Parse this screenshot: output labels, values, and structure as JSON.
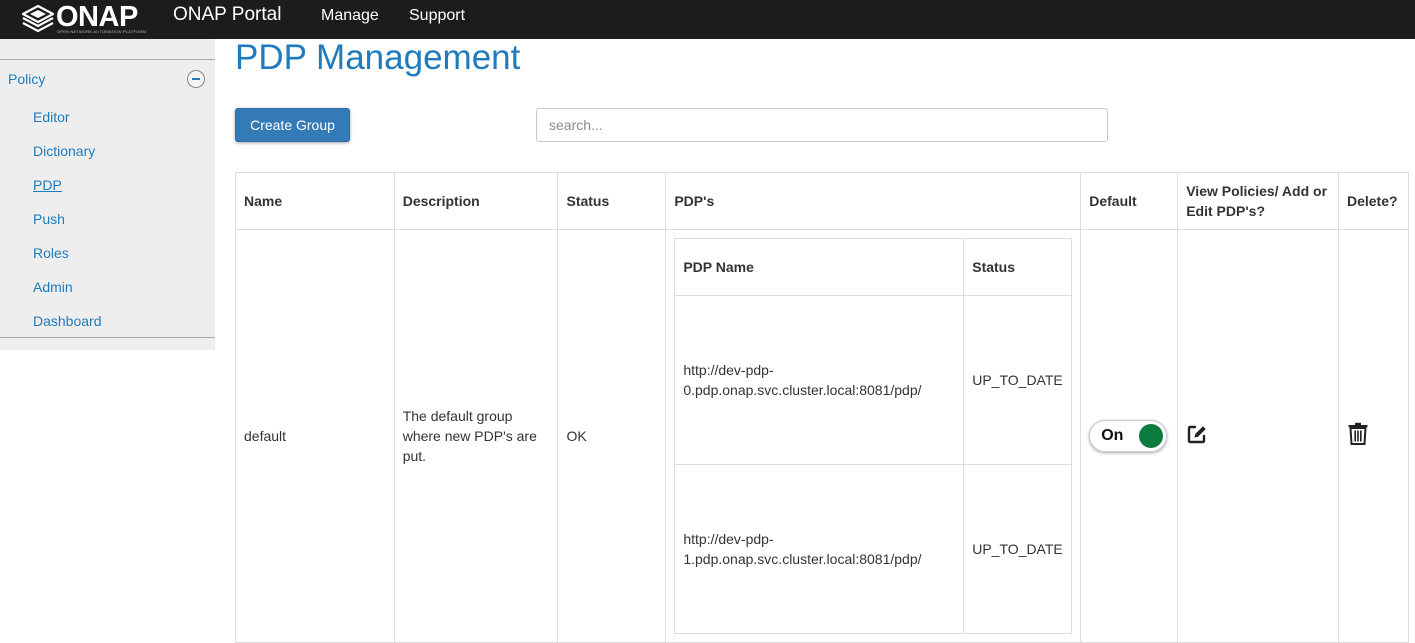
{
  "header": {
    "logo_text": "ONAP",
    "logo_subtext": "OPEN NETWORK AUTOMATION PLATFORM",
    "brand": "ONAP Portal",
    "nav": [
      "Manage",
      "Support"
    ]
  },
  "sidebar": {
    "section": "Policy",
    "items": [
      {
        "label": "Editor"
      },
      {
        "label": "Dictionary"
      },
      {
        "label": "PDP",
        "active": true
      },
      {
        "label": "Push"
      },
      {
        "label": "Roles"
      },
      {
        "label": "Admin"
      },
      {
        "label": "Dashboard"
      }
    ]
  },
  "main": {
    "title": "PDP Management",
    "create_button": "Create Group",
    "search_placeholder": "search...",
    "table": {
      "headers": {
        "name": "Name",
        "description": "Description",
        "status": "Status",
        "pdps": "PDP's",
        "default": "Default",
        "view": "View Policies/ Add or Edit PDP's?",
        "delete": "Delete?"
      },
      "rows": [
        {
          "name": "default",
          "description": "The default group where new PDP's are put.",
          "status": "OK",
          "pdp_headers": {
            "name": "PDP Name",
            "status": "Status"
          },
          "pdps": [
            {
              "name": "http://dev-pdp-0.pdp.onap.svc.cluster.local:8081/pdp/",
              "status": "UP_TO_DATE"
            },
            {
              "name": "http://dev-pdp-1.pdp.onap.svc.cluster.local:8081/pdp/",
              "status": "UP_TO_DATE"
            }
          ],
          "default_label": "On",
          "default_on": true
        }
      ]
    }
  },
  "icons": {
    "collapse": "minus-circle-icon",
    "edit": "edit-square-icon",
    "delete": "trash-icon"
  },
  "colors": {
    "topbar": "#1c1c1c",
    "link": "#1f7bbd",
    "primary_button": "#337ab7",
    "toggle_on": "#0d7a3e",
    "sidebar_bg": "#eeeeee"
  }
}
